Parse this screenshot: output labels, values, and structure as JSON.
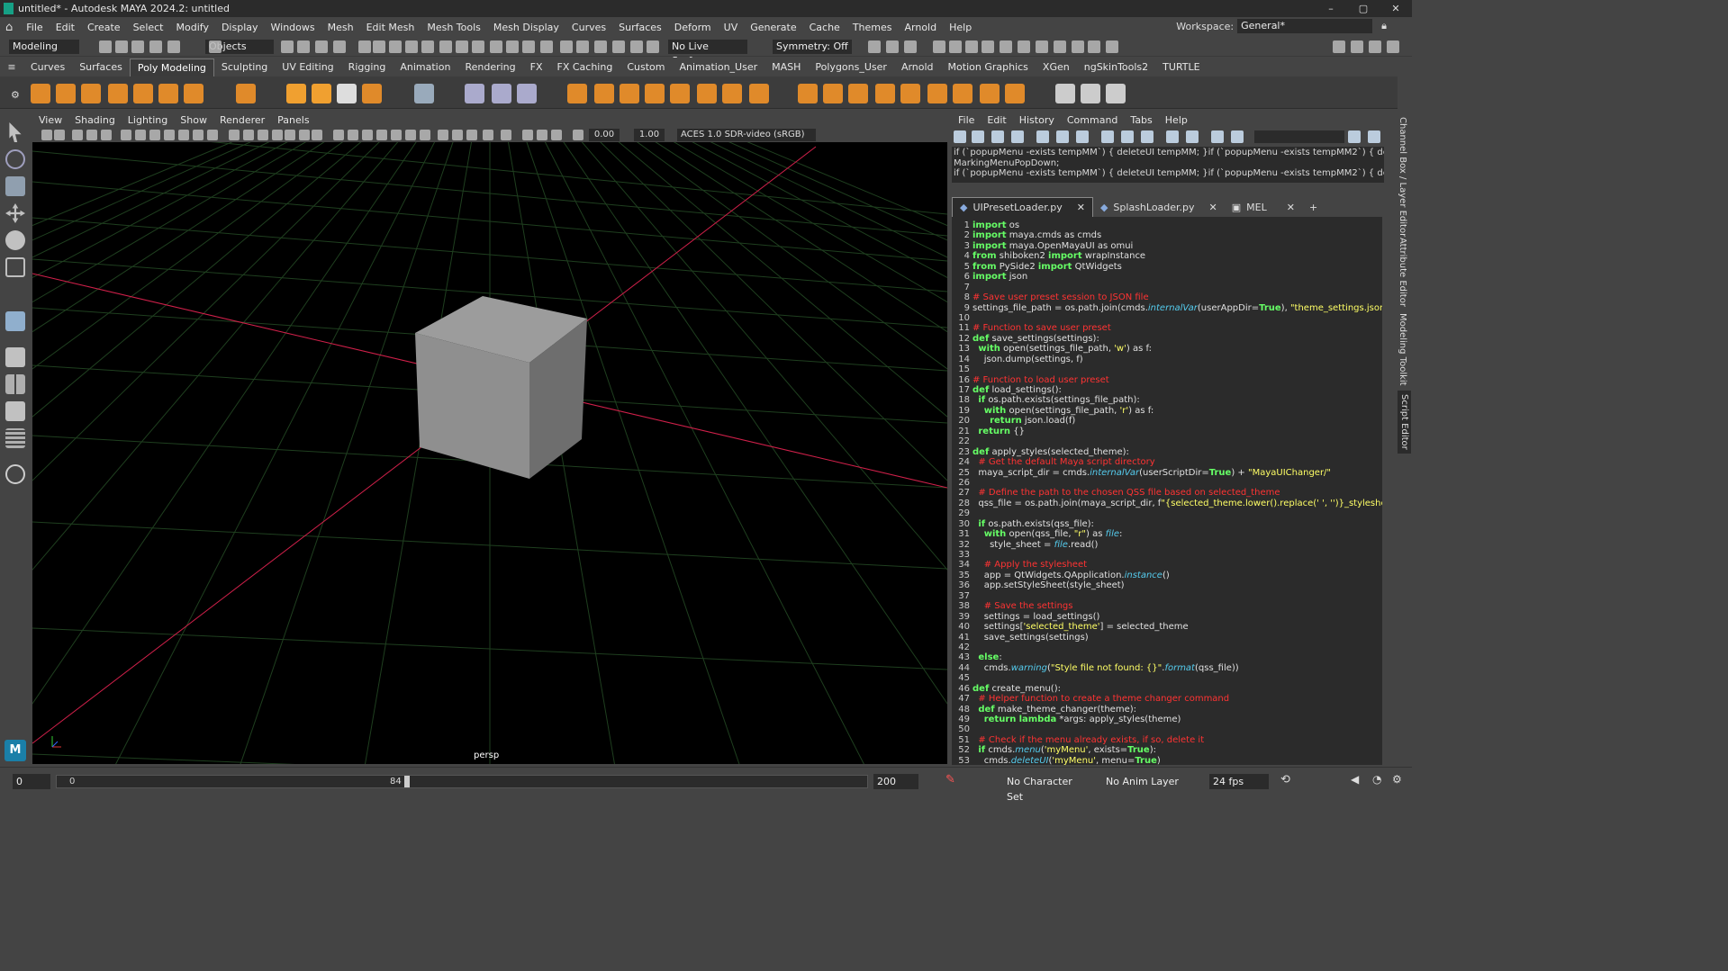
{
  "window": {
    "title": "untitled* - Autodesk MAYA 2024.2: untitled",
    "minimize": "–",
    "maximize": "▢",
    "close": "✕"
  },
  "menu": [
    "File",
    "Edit",
    "Create",
    "Select",
    "Modify",
    "Display",
    "Windows",
    "Mesh",
    "Edit Mesh",
    "Mesh Tools",
    "Mesh Display",
    "Curves",
    "Surfaces",
    "Deform",
    "UV",
    "Generate",
    "Cache",
    "Themes",
    "Arnold",
    "Help"
  ],
  "workspace": {
    "label": "Workspace:",
    "value": "General*"
  },
  "status": {
    "mode": "Modeling",
    "selection_mode": "Objects",
    "live_surface": "No Live Surface",
    "symmetry": "Symmetry: Off"
  },
  "shelf_tabs": [
    "Curves",
    "Surfaces",
    "Poly Modeling",
    "Sculpting",
    "UV Editing",
    "Rigging",
    "Animation",
    "Rendering",
    "FX",
    "FX Caching",
    "Custom",
    "Animation_User",
    "MASH",
    "Polygons_User",
    "Arnold",
    "Motion Graphics",
    "XGen",
    "ngSkinTools2",
    "TURTLE"
  ],
  "active_shelf_tab": "Poly Modeling",
  "viewport": {
    "menu": [
      "View",
      "Shading",
      "Lighting",
      "Show",
      "Renderer",
      "Panels"
    ],
    "exposure": "0.00",
    "gamma": "1.00",
    "color_space": "ACES 1.0 SDR-video (sRGB)",
    "camera_label": "persp"
  },
  "script_editor": {
    "menu": [
      "File",
      "Edit",
      "History",
      "Command",
      "Tabs",
      "Help"
    ],
    "output": [
      "if (`popupMenu -exists tempMM`) { deleteUI tempMM; }if (`popupMenu -exists tempMM2`) { deleteUI temp",
      "MarkingMenuPopDown;",
      "if (`popupMenu -exists tempMM`) { deleteUI tempMM; }if (`popupMenu -exists tempMM2`) { deleteUI temp"
    ],
    "tabs": [
      {
        "label": "UIPresetLoader.py",
        "active": true
      },
      {
        "label": "SplashLoader.py",
        "active": false
      },
      {
        "label": "MEL",
        "active": false
      }
    ],
    "add_tab": "+",
    "code": [
      [
        [
          "kw",
          "import"
        ],
        [
          "t",
          " os"
        ]
      ],
      [
        [
          "kw",
          "import"
        ],
        [
          "t",
          " maya.cmds as cmds"
        ]
      ],
      [
        [
          "kw",
          "import"
        ],
        [
          "t",
          " maya.OpenMayaUI as omui"
        ]
      ],
      [
        [
          "kw",
          "from"
        ],
        [
          "t",
          " shiboken2 "
        ],
        [
          "kw",
          "import"
        ],
        [
          "t",
          " wrapInstance"
        ]
      ],
      [
        [
          "kw",
          "from"
        ],
        [
          "t",
          " PySide2 "
        ],
        [
          "kw",
          "import"
        ],
        [
          "t",
          " QtWidgets"
        ]
      ],
      [
        [
          "kw",
          "import"
        ],
        [
          "t",
          " json"
        ]
      ],
      [],
      [
        [
          "cm",
          "# Save user preset session to JSON file"
        ]
      ],
      [
        [
          "t",
          "settings_file_path = os.path.join(cmds."
        ],
        [
          "it",
          "internalVar"
        ],
        [
          "t",
          "(userAppDir="
        ],
        [
          "kw",
          "True"
        ],
        [
          "t",
          "), "
        ],
        [
          "st2",
          "\"theme_settings.json\""
        ],
        [
          "t",
          ")"
        ]
      ],
      [],
      [
        [
          "cm",
          "# Function to save user preset"
        ]
      ],
      [
        [
          "kw",
          "def"
        ],
        [
          "t",
          " save_settings(settings):"
        ]
      ],
      [
        [
          "t",
          "  "
        ],
        [
          "kw",
          "with"
        ],
        [
          "t",
          " open(settings_file_path, "
        ],
        [
          "st2",
          "'w'"
        ],
        [
          "t",
          ") as f:"
        ]
      ],
      [
        [
          "t",
          "    json.dump(settings, f)"
        ]
      ],
      [],
      [
        [
          "cm",
          "# Function to load user preset"
        ]
      ],
      [
        [
          "kw",
          "def"
        ],
        [
          "t",
          " load_settings():"
        ]
      ],
      [
        [
          "t",
          "  "
        ],
        [
          "kw",
          "if"
        ],
        [
          "t",
          " os.path.exists(settings_file_path):"
        ]
      ],
      [
        [
          "t",
          "    "
        ],
        [
          "kw",
          "with"
        ],
        [
          "t",
          " open(settings_file_path, "
        ],
        [
          "st2",
          "'r'"
        ],
        [
          "t",
          ") as f:"
        ]
      ],
      [
        [
          "t",
          "      "
        ],
        [
          "kw",
          "return"
        ],
        [
          "t",
          " json.load(f)"
        ]
      ],
      [
        [
          "t",
          "  "
        ],
        [
          "kw",
          "return"
        ],
        [
          "t",
          " {}"
        ]
      ],
      [],
      [
        [
          "kw",
          "def"
        ],
        [
          "t",
          " apply_styles(selected_theme):"
        ]
      ],
      [
        [
          "t",
          "  "
        ],
        [
          "cm",
          "# Get the default Maya script directory"
        ]
      ],
      [
        [
          "t",
          "  maya_script_dir = cmds."
        ],
        [
          "it",
          "internalVar"
        ],
        [
          "t",
          "(userScriptDir="
        ],
        [
          "kw",
          "True"
        ],
        [
          "t",
          ") + "
        ],
        [
          "st2",
          "\"MayaUIChanger/\""
        ]
      ],
      [],
      [
        [
          "t",
          "  "
        ],
        [
          "cm",
          "# Define the path to the chosen QSS file based on selected_theme"
        ]
      ],
      [
        [
          "t",
          "  qss_file = os.path.join(maya_script_dir, f"
        ],
        [
          "st2",
          "\"{selected_theme.lower().replace(' ', '')}_stylesheet.qss\""
        ],
        [
          "t",
          ")"
        ]
      ],
      [],
      [
        [
          "t",
          "  "
        ],
        [
          "kw",
          "if"
        ],
        [
          "t",
          " os.path.exists(qss_file):"
        ]
      ],
      [
        [
          "t",
          "    "
        ],
        [
          "kw",
          "with"
        ],
        [
          "t",
          " open(qss_file, "
        ],
        [
          "st2",
          "\"r\""
        ],
        [
          "t",
          ") as "
        ],
        [
          "it",
          "file"
        ],
        [
          "t",
          ":"
        ]
      ],
      [
        [
          "t",
          "      style_sheet = "
        ],
        [
          "it",
          "file"
        ],
        [
          "t",
          ".read()"
        ]
      ],
      [],
      [
        [
          "t",
          "    "
        ],
        [
          "cm",
          "# Apply the stylesheet"
        ]
      ],
      [
        [
          "t",
          "    app = QtWidgets.QApplication."
        ],
        [
          "it",
          "instance"
        ],
        [
          "t",
          "()"
        ]
      ],
      [
        [
          "t",
          "    app.setStyleSheet(style_sheet)"
        ]
      ],
      [],
      [
        [
          "t",
          "    "
        ],
        [
          "cm",
          "# Save the settings"
        ]
      ],
      [
        [
          "t",
          "    settings = load_settings()"
        ]
      ],
      [
        [
          "t",
          "    settings["
        ],
        [
          "st2",
          "'selected_theme'"
        ],
        [
          "t",
          "] = selected_theme"
        ]
      ],
      [
        [
          "t",
          "    save_settings(settings)"
        ]
      ],
      [],
      [
        [
          "t",
          "  "
        ],
        [
          "kw",
          "else"
        ],
        [
          "t",
          ":"
        ]
      ],
      [
        [
          "t",
          "    cmds."
        ],
        [
          "it",
          "warning"
        ],
        [
          "t",
          "("
        ],
        [
          "st2",
          "\"Style file not found: {}\""
        ],
        [
          "t",
          "."
        ],
        [
          "it",
          "format"
        ],
        [
          "t",
          "(qss_file))"
        ]
      ],
      [],
      [
        [
          "kw",
          "def"
        ],
        [
          "t",
          " create_menu():"
        ]
      ],
      [
        [
          "t",
          "  "
        ],
        [
          "cm",
          "# Helper function to create a theme changer command"
        ]
      ],
      [
        [
          "t",
          "  "
        ],
        [
          "kw",
          "def"
        ],
        [
          "t",
          " make_theme_changer(theme):"
        ]
      ],
      [
        [
          "t",
          "    "
        ],
        [
          "kw",
          "return"
        ],
        [
          "t",
          " "
        ],
        [
          "kw",
          "lambda"
        ],
        [
          "t",
          " *args: apply_styles(theme)"
        ]
      ],
      [],
      [
        [
          "t",
          "  "
        ],
        [
          "cm",
          "# Check if the menu already exists, if so, delete it"
        ]
      ],
      [
        [
          "t",
          "  "
        ],
        [
          "kw",
          "if"
        ],
        [
          "t",
          " cmds."
        ],
        [
          "it",
          "menu"
        ],
        [
          "t",
          "("
        ],
        [
          "st2",
          "'myMenu'"
        ],
        [
          "t",
          ", exists="
        ],
        [
          "kw",
          "True"
        ],
        [
          "t",
          "):"
        ]
      ],
      [
        [
          "t",
          "    cmds."
        ],
        [
          "it",
          "deleteUI"
        ],
        [
          "t",
          "("
        ],
        [
          "st2",
          "'myMenu'"
        ],
        [
          "t",
          ", menu="
        ],
        [
          "kw",
          "True"
        ],
        [
          "t",
          ")"
        ]
      ]
    ]
  },
  "side_tabs": [
    "Channel Box / Layer Editor",
    "Attribute Editor",
    "Modeling Toolkit",
    "Script Editor"
  ],
  "timeline": {
    "start": "0",
    "range_start": "0",
    "current": "84",
    "range_end": "200",
    "character_set": "No Character Set",
    "anim_layer": "No Anim Layer",
    "fps": "24 fps"
  },
  "colors": {
    "bg": "#444444",
    "panel": "#2b2b2b",
    "keyword": "#66ff66",
    "comment": "#ff3333",
    "string": "#ffff66",
    "builtin": "#55ccee",
    "grid": "#1f3f1f",
    "axis_x": "#d0204a",
    "cube": "#9a9a9a"
  }
}
